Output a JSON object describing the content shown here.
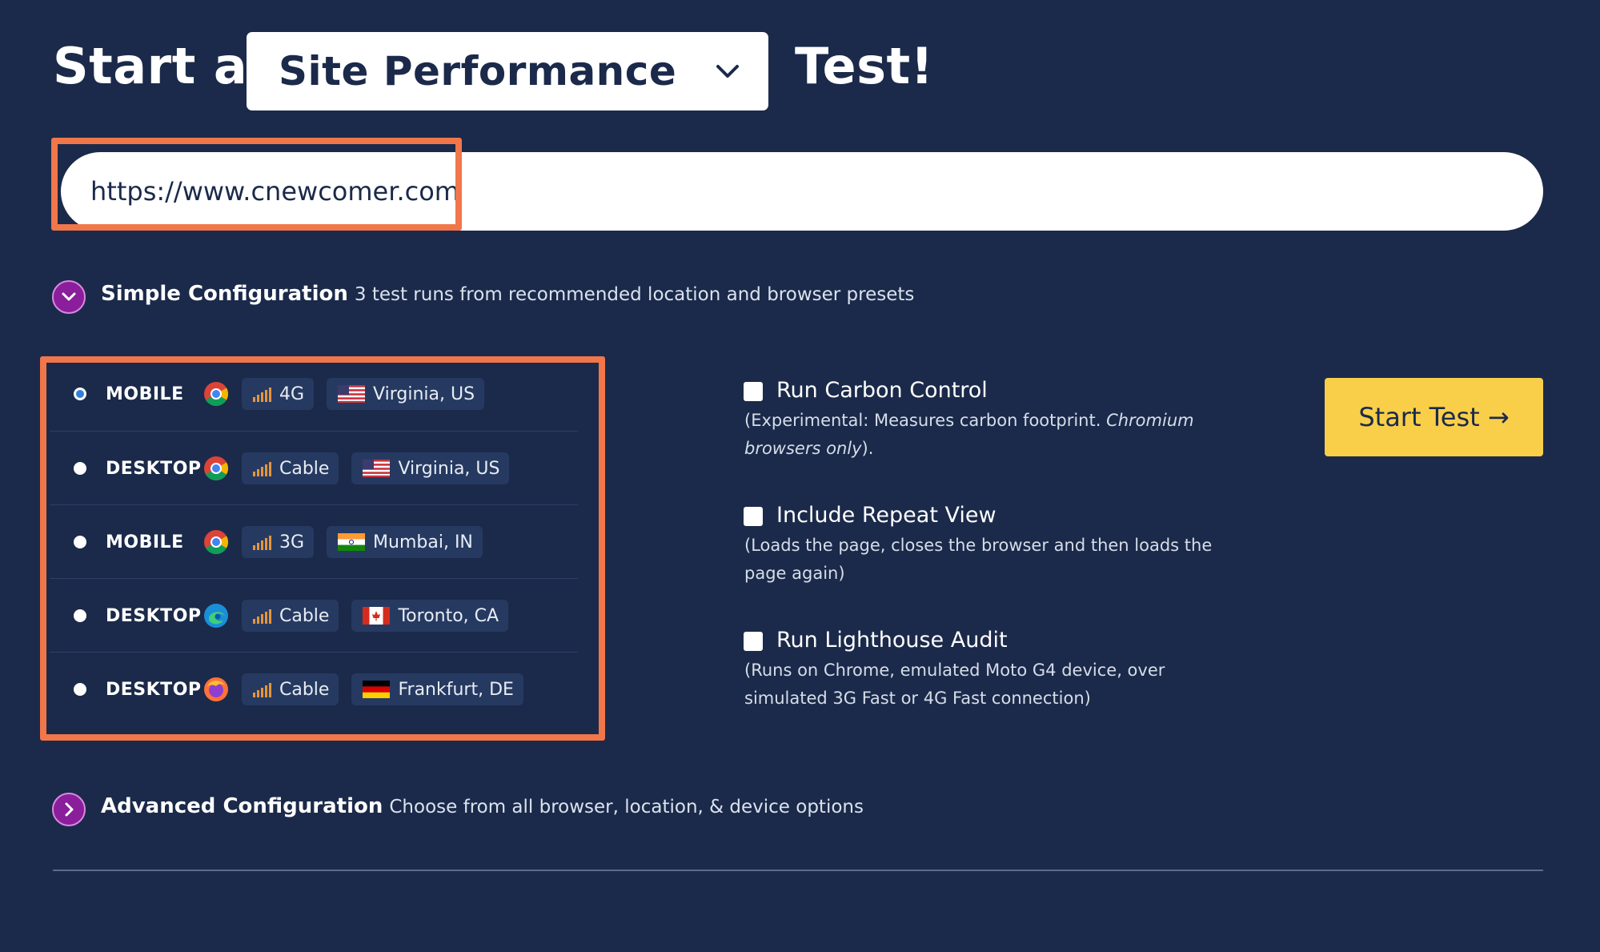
{
  "header": {
    "title_prefix": "Start a",
    "test_type_selected": "Site Performance",
    "title_suffix": "Test!"
  },
  "url_input": {
    "value": "https://www.cnewcomer.com"
  },
  "simple_config": {
    "title": "Simple Configuration",
    "description": "3 test runs from recommended location and browser presets",
    "toggle_icon": "chevron-down-icon"
  },
  "presets": [
    {
      "device": "MOBILE",
      "browser": "chrome-icon",
      "connection": "4G",
      "location": "Virginia, US",
      "flag": "us-flag-icon",
      "selected": true
    },
    {
      "device": "DESKTOP",
      "browser": "chrome-icon",
      "connection": "Cable",
      "location": "Virginia, US",
      "flag": "us-flag-icon",
      "selected": false
    },
    {
      "device": "MOBILE",
      "browser": "chrome-icon",
      "connection": "3G",
      "location": "Mumbai, IN",
      "flag": "india-flag-icon",
      "selected": false
    },
    {
      "device": "DESKTOP",
      "browser": "edge-icon",
      "connection": "Cable",
      "location": "Toronto, CA",
      "flag": "canada-flag-icon",
      "selected": false
    },
    {
      "device": "DESKTOP",
      "browser": "firefox-icon",
      "connection": "Cable",
      "location": "Frankfurt, DE",
      "flag": "germany-flag-icon",
      "selected": false
    }
  ],
  "options": {
    "carbon": {
      "label": "Run Carbon Control",
      "desc_main": "(Experimental: Measures carbon footprint. ",
      "desc_italic": "Chromium browsers only",
      "desc_end": ").",
      "checked": false
    },
    "repeat": {
      "label": "Include Repeat View",
      "desc": "(Loads the page, closes the browser and then loads the page again)",
      "checked": false
    },
    "lighthouse": {
      "label": "Run Lighthouse Audit",
      "desc": "(Runs on Chrome, emulated Moto G4 device, over simulated 3G Fast or 4G Fast connection)",
      "checked": false
    }
  },
  "start_button": {
    "label": "Start Test →"
  },
  "advanced_config": {
    "title": "Advanced Configuration",
    "description": "Choose from all browser, location, & device options",
    "toggle_icon": "chevron-right-icon"
  },
  "colors": {
    "background": "#1b2a4a",
    "highlight": "#f1764a",
    "start_button": "#f9cf4a",
    "toggle": "#8a1e9b",
    "signal": "#e8953a"
  }
}
